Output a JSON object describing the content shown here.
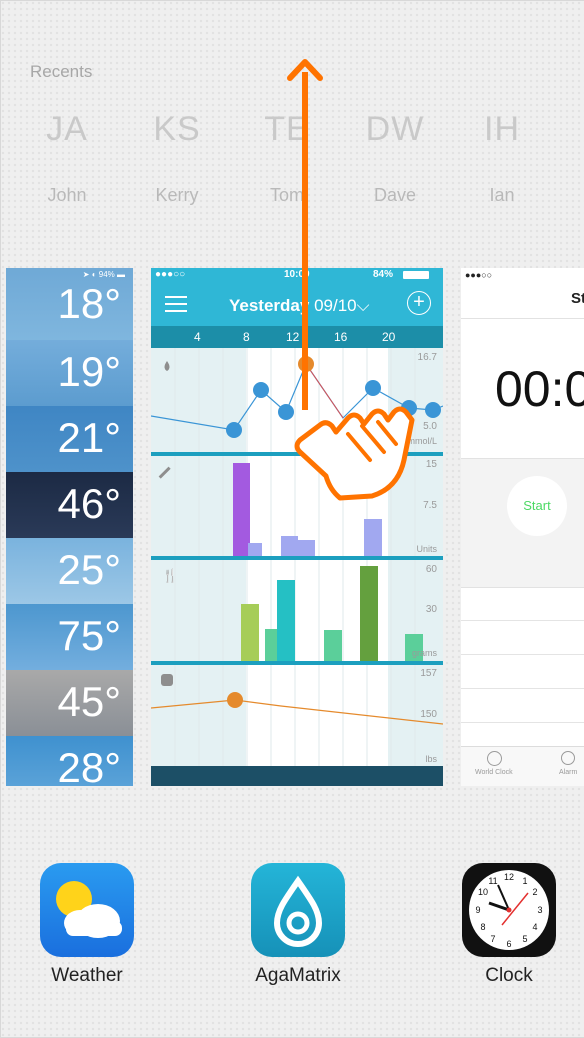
{
  "recents": {
    "label": "Recents",
    "contacts": [
      {
        "initials": "JA",
        "name": "John"
      },
      {
        "initials": "KS",
        "name": "Kerry"
      },
      {
        "initials": "TE",
        "name": "Tom"
      },
      {
        "initials": "DW",
        "name": "Dave"
      },
      {
        "initials": "IH",
        "name": "Ian"
      }
    ]
  },
  "weather_card": {
    "status": "94%",
    "temps": [
      "18°",
      "19°",
      "21°",
      "46°",
      "25°",
      "75°",
      "45°",
      "28°"
    ]
  },
  "aga_card": {
    "status_left": "●●●○○",
    "status_time": "10:09",
    "status_battery": "84%",
    "title_bold": "Yesterday",
    "title_date": "09/10",
    "hours": [
      "4",
      "8",
      "12",
      "16",
      "20"
    ],
    "glucose": {
      "max": "16.7",
      "mid": "5.0",
      "unit": "mmol/L"
    },
    "insulin": {
      "max": "15",
      "mid": "7.5",
      "unit": "Units"
    },
    "carbs": {
      "max": "60",
      "mid": "30",
      "unit": "grams"
    },
    "weight": {
      "max": "157",
      "mid": "150",
      "unit": "lbs"
    }
  },
  "clock_card": {
    "status": "●●●○○",
    "title": "St",
    "time": "00:0",
    "start_label": "Start",
    "tabs": [
      "World Clock",
      "Alarm"
    ]
  },
  "dock": [
    {
      "name": "Weather"
    },
    {
      "name": "AgaMatrix"
    },
    {
      "name": "Clock"
    }
  ],
  "colors": {
    "aga_teal": "#2fb7d6",
    "aga_dark": "#1c8ea8",
    "swipe_arrow": "#ff7300",
    "start_green": "#4cd964"
  }
}
